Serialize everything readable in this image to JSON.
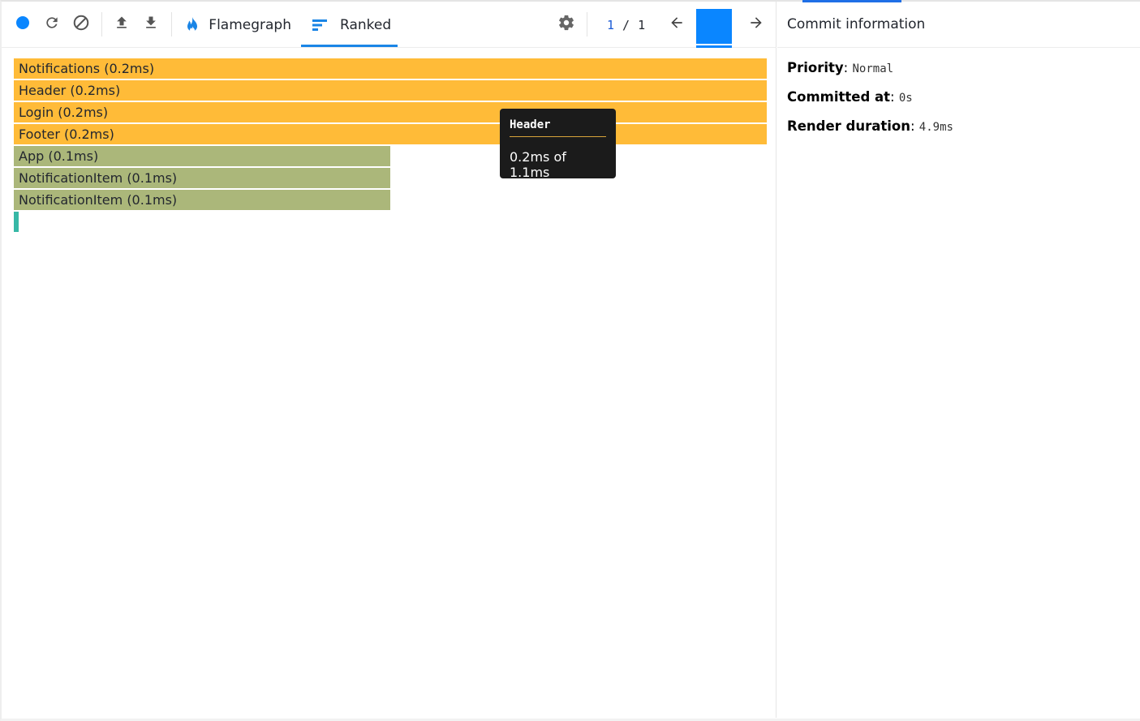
{
  "toolbar": {
    "record_icon": "record-dot-icon",
    "reload_icon": "reload-icon",
    "clear_icon": "clear-icon",
    "upload_icon": "upload-icon",
    "download_icon": "download-icon",
    "settings_icon": "gear-icon",
    "tabs": [
      {
        "label": "Flamegraph",
        "icon": "flame-icon",
        "active": false
      },
      {
        "label": "Ranked",
        "icon": "ranked-icon",
        "active": true
      }
    ],
    "commit_index": "1",
    "commit_separator": "/",
    "commit_total": "1",
    "prev_icon": "arrow-left-icon",
    "next_icon": "arrow-right-icon"
  },
  "colors": {
    "accent": "#1a85e6",
    "bar_slow": "#ffbb38",
    "bar_medium": "#abb77a",
    "bar_fast": "#37b8a6",
    "commit_bar": "#0a86ff"
  },
  "ranked": {
    "total_ms": 1.1,
    "items": [
      {
        "label": "Notifications (0.2ms)",
        "value_ms": 0.2
      },
      {
        "label": "Header (0.2ms)",
        "value_ms": 0.2
      },
      {
        "label": "Login (0.2ms)",
        "value_ms": 0.2
      },
      {
        "label": "Footer (0.2ms)",
        "value_ms": 0.2
      },
      {
        "label": "App (0.1ms)",
        "value_ms": 0.1
      },
      {
        "label": "NotificationItem (0.1ms)",
        "value_ms": 0.1
      },
      {
        "label": "NotificationItem (0.1ms)",
        "value_ms": 0.1
      },
      {
        "label": "",
        "value_ms": 0.0
      }
    ]
  },
  "tooltip": {
    "title": "Header",
    "body": "0.2ms of 1.1ms"
  },
  "commit_info": {
    "header": "Commit information",
    "priority_label": "Priority",
    "priority_value": "Normal",
    "committed_label": "Committed at",
    "committed_value": "0s",
    "duration_label": "Render duration",
    "duration_value": "4.9ms"
  }
}
